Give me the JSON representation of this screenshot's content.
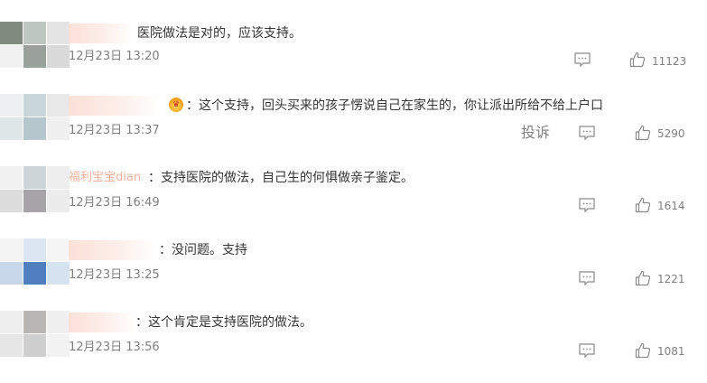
{
  "comments": [
    {
      "text": "医院做法是对的，应该支持。",
      "time": "12月23日 13:20",
      "likes": "11123",
      "avatar_colors": [
        "#7f8a7f",
        "#bfc8c0",
        "#e4e4e4",
        "#f1f1f1",
        "#9aa09c",
        "#d9d9d9"
      ]
    },
    {
      "text": "：这个支持，回头买来的孩子愣说自己在家生的，你让派出所给不给上户口",
      "time": "12月23日 13:37",
      "likes": "5290",
      "report_label": "投诉",
      "avatar_colors": [
        "#eef1f2",
        "#c9d7dc",
        "#e8e8e8",
        "#dfe6e8",
        "#b5c7cc",
        "#f0f0f0"
      ]
    },
    {
      "text": "：支持医院的做法，自己生的何惧做亲子鉴定。",
      "time": "12月23日 16:49",
      "likes": "1614",
      "name_fragment": "福利宝宝dian",
      "avatar_colors": [
        "#f1f1f1",
        "#ccd6d8",
        "#eeeeee",
        "#dcdcdc",
        "#a7a4a8",
        "#ececec"
      ]
    },
    {
      "text": "：没问题。支持",
      "time": "12月23日 13:25",
      "likes": "1221",
      "avatar_colors": [
        "#f3f3f3",
        "#dce6f0",
        "#f5f5f5",
        "#c8d8ea",
        "#4f7fbf",
        "#d7e3f0"
      ]
    },
    {
      "text": "：这个肯定是支持医院的做法。",
      "time": "12月23日 13:56",
      "likes": "1081",
      "avatar_colors": [
        "#eeeeee",
        "#b9b6b4",
        "#f0f0f0",
        "#e6e6e6",
        "#cfcfcf",
        "#f2f2f2"
      ]
    }
  ],
  "icons": {
    "reply": "comment-bubble-icon",
    "like": "thumbs-up-icon",
    "badge": "crown-badge-icon"
  },
  "colors": {
    "text": "#333333",
    "meta": "#808080",
    "username": "#eb7350"
  }
}
